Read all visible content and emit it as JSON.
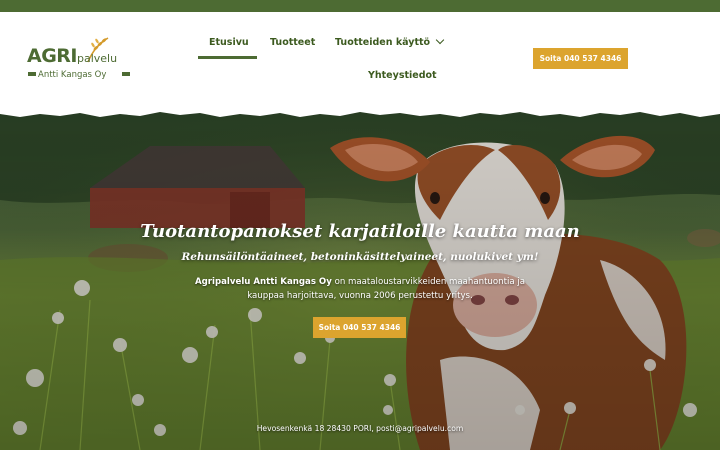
{
  "logo": {
    "brand_agri": "AGRI",
    "brand_palvelu": "palvelu",
    "company": "Antti Kangas Oy"
  },
  "nav": {
    "items": [
      {
        "label": "Etusivu",
        "active": true
      },
      {
        "label": "Tuotteet",
        "active": false
      },
      {
        "label": "Tuotteiden käyttö",
        "active": false,
        "has_dropdown": true
      },
      {
        "label": "Yhteystiedot",
        "active": false
      }
    ],
    "call_button": "Soita 040 537 4346"
  },
  "hero": {
    "title": "Tuotantopanokset karjatiloille kautta maan",
    "subtitle": "Rehunsäilöntäaineet, betoninkäsittelyaineet, nuolukivet ym!",
    "description_strong": "Agripalvelu Antti Kangas Oy",
    "description_rest": " on maataloustarvikkeiden maahantuontia ja kauppaa harjoittava, vuonna 2006 perustettu yritys.",
    "call_button": "Soita 040 537 4346",
    "address": "Hevosenkenkä 18 28430 PORI, posti@agripalvelu.com"
  },
  "colors": {
    "brand_green": "#4d6b33",
    "nav_text": "#3c5a1f",
    "accent_gold": "#dca42e"
  }
}
